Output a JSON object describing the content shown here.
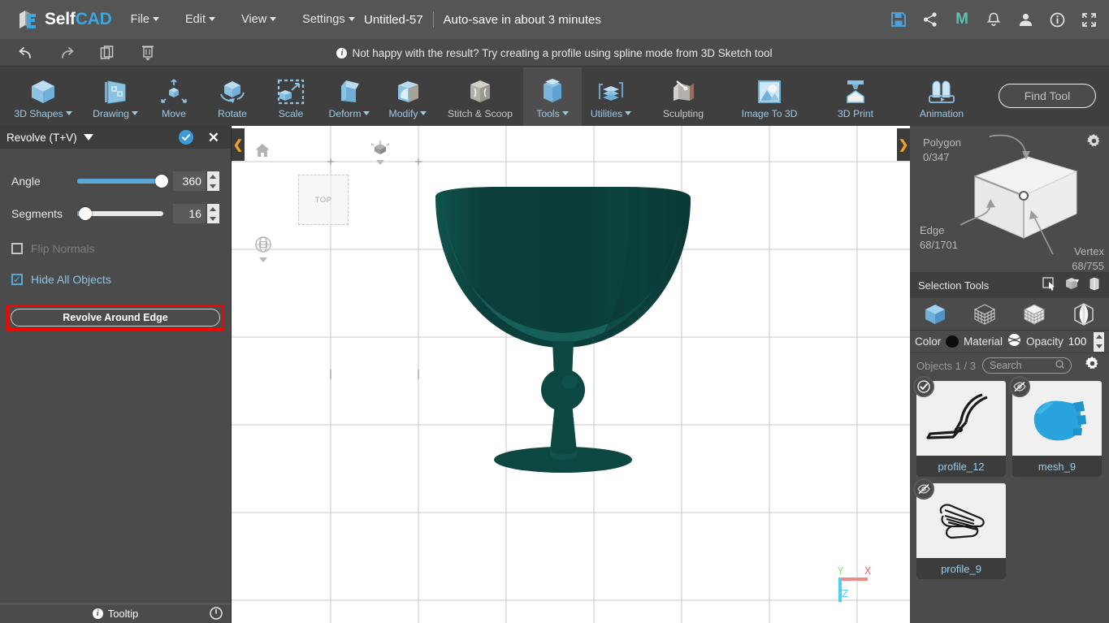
{
  "app": {
    "brand_self": "Self",
    "brand_cad": "CAD",
    "doc_title": "Untitled-57",
    "autosave": "Auto-save in about 3 minutes"
  },
  "menu": [
    {
      "label": "File",
      "caret": true
    },
    {
      "label": "Edit",
      "caret": true
    },
    {
      "label": "View",
      "caret": true
    },
    {
      "label": "Settings",
      "caret": true
    }
  ],
  "top_icons": [
    {
      "name": "save-icon",
      "glyph": "save"
    },
    {
      "name": "share-icon",
      "glyph": "share"
    },
    {
      "name": "magic-m-icon",
      "glyph": "M"
    },
    {
      "name": "notifications-bell-icon",
      "glyph": "bell"
    },
    {
      "name": "user-account-icon",
      "glyph": "user"
    },
    {
      "name": "info-icon",
      "glyph": "info"
    },
    {
      "name": "fullscreen-icon",
      "glyph": "expand"
    }
  ],
  "action_bar": {
    "undo": "undo",
    "redo": "redo",
    "copy": "copy",
    "delete": "delete",
    "hint": "Not happy with the result? Try creating a profile using spline mode from 3D Sketch tool"
  },
  "toolbar": {
    "find_tool_placeholder": "Find Tool",
    "tools": [
      {
        "label": "3D Shapes",
        "caret": true,
        "active": false,
        "icon": "cube-icon"
      },
      {
        "label": "Drawing",
        "caret": true,
        "active": false,
        "icon": "drawing-icon"
      },
      {
        "label": "Move",
        "caret": false,
        "active": false,
        "icon": "move-icon"
      },
      {
        "label": "Rotate",
        "caret": false,
        "active": false,
        "icon": "rotate-icon"
      },
      {
        "label": "Scale",
        "caret": false,
        "active": false,
        "icon": "scale-icon"
      },
      {
        "label": "Deform",
        "caret": true,
        "active": false,
        "icon": "deform-icon"
      },
      {
        "label": "Modify",
        "caret": true,
        "active": false,
        "icon": "modify-icon"
      },
      {
        "label": "Stitch & Scoop",
        "caret": false,
        "active": false,
        "icon": "stitch-scoop-icon"
      },
      {
        "label": "Tools",
        "caret": true,
        "active": true,
        "icon": "tools-icon"
      },
      {
        "label": "Utilities",
        "caret": true,
        "active": false,
        "icon": "utilities-icon"
      },
      {
        "label": "Sculpting",
        "caret": false,
        "active": false,
        "icon": "sculpting-icon"
      },
      {
        "label": "Image To 3D",
        "caret": false,
        "active": false,
        "icon": "image-to-3d-icon"
      },
      {
        "label": "3D Print",
        "caret": false,
        "active": false,
        "icon": "3d-print-icon"
      },
      {
        "label": "Animation",
        "caret": false,
        "active": false,
        "icon": "animation-icon"
      }
    ]
  },
  "left_panel": {
    "title": "Revolve (T+V)",
    "angle": {
      "label": "Angle",
      "value": "360",
      "percent": 100
    },
    "segments": {
      "label": "Segments",
      "value": "16",
      "percent": 2
    },
    "flip_normals": {
      "label": "Flip Normals",
      "checked": false,
      "disabled": true
    },
    "hide_all_objects": {
      "label": "Hide All Objects",
      "checked": true,
      "disabled": false
    },
    "revolve_button": "Revolve Around Edge",
    "footer_label": "Tooltip"
  },
  "viewport": {
    "top_face_label": "TOP",
    "axis": {
      "x": "X",
      "y": "Y",
      "z": "Z"
    },
    "model_color": "#0d4742",
    "model_highlight": "#17635c"
  },
  "right_panel": {
    "mesh_info": {
      "polygon_label": "Polygon",
      "polygon_value": "0/347",
      "edge_label": "Edge",
      "edge_value": "68/1701",
      "vertex_label": "Vertex",
      "vertex_value": "68/755"
    },
    "selection_tools_label": "Selection Tools",
    "selection_icons": [
      "rect-select-icon",
      "box-select-icon",
      "loop-select-icon"
    ],
    "mode_icons": [
      "object-mode-icon",
      "vertex-mode-icon",
      "edge-mode-icon",
      "face-mode-icon"
    ],
    "color_label": "Color",
    "color_value": "#0d0d0d",
    "material_label": "Material",
    "opacity_label": "Opacity",
    "opacity_value": "100",
    "objects_count": "Objects 1 / 3",
    "search_placeholder": "Search",
    "objects": [
      {
        "name": "profile_12",
        "badge": "check",
        "thumb": "profile-curve"
      },
      {
        "name": "mesh_9",
        "badge": "hidden",
        "thumb": "blue-mesh"
      },
      {
        "name": "profile_9",
        "badge": "hidden",
        "thumb": "profile-loops"
      }
    ]
  },
  "colors": {
    "accent_blue": "#3aa7e0",
    "tool_label_blue": "#9ccbe8",
    "highlight_red": "#ff0000",
    "panel_bg": "#4b4b4b"
  }
}
